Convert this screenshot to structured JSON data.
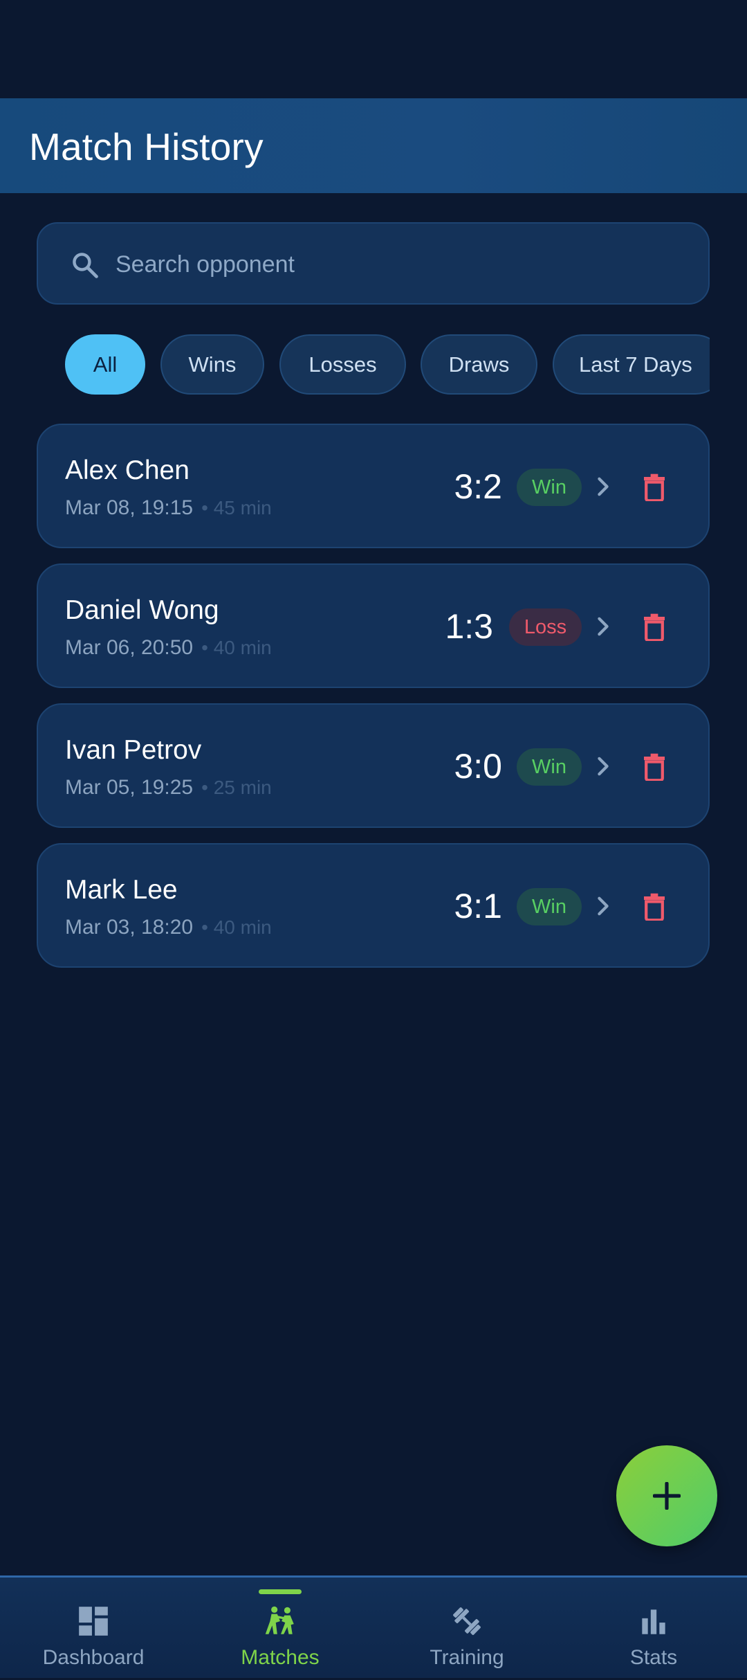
{
  "app_bar": {
    "title": "Match History"
  },
  "search": {
    "placeholder": "Search opponent",
    "value": ""
  },
  "filters": [
    {
      "label": "All",
      "active": true
    },
    {
      "label": "Wins",
      "active": false
    },
    {
      "label": "Losses",
      "active": false
    },
    {
      "label": "Draws",
      "active": false
    },
    {
      "label": "Last 7 Days",
      "active": false
    }
  ],
  "matches": [
    {
      "opponent": "Alex Chen",
      "datetime": "Mar 08, 19:15",
      "duration": "• 45 min",
      "score": "3:2",
      "result": "Win"
    },
    {
      "opponent": "Daniel Wong",
      "datetime": "Mar 06, 20:50",
      "duration": "• 40 min",
      "score": "1:3",
      "result": "Loss"
    },
    {
      "opponent": "Ivan Petrov",
      "datetime": "Mar 05, 19:25",
      "duration": "• 25 min",
      "score": "3:0",
      "result": "Win"
    },
    {
      "opponent": "Mark Lee",
      "datetime": "Mar 03, 18:20",
      "duration": "• 40 min",
      "score": "3:1",
      "result": "Win"
    }
  ],
  "fab": {
    "icon": "plus-icon"
  },
  "nav": [
    {
      "label": "Dashboard",
      "icon": "dashboard-icon",
      "active": false
    },
    {
      "label": "Matches",
      "icon": "sports-matches-icon",
      "active": true
    },
    {
      "label": "Training",
      "icon": "dumbbell-icon",
      "active": false
    },
    {
      "label": "Stats",
      "icon": "bar-chart-icon",
      "active": false
    }
  ],
  "colors": {
    "background": "#0b1830",
    "accent_green": "#7fd44a",
    "filter_active": "#4fc1f5",
    "win": "#58cf63",
    "loss": "#ef5a6b",
    "delete": "#ef5a6b"
  }
}
